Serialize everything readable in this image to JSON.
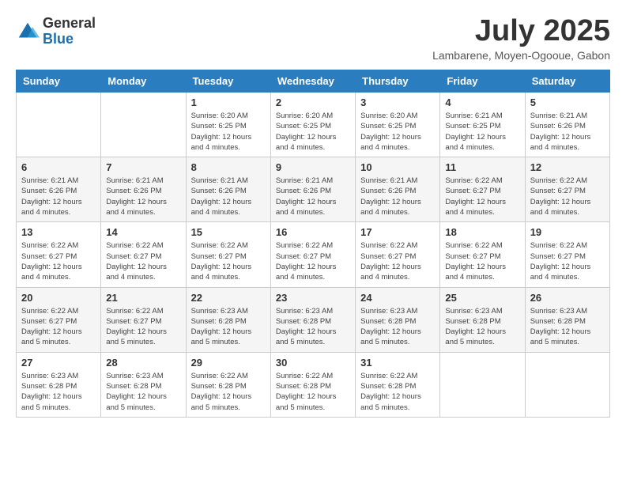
{
  "logo": {
    "general": "General",
    "blue": "Blue"
  },
  "title": "July 2025",
  "subtitle": "Lambarene, Moyen-Ogooue, Gabon",
  "days_of_week": [
    "Sunday",
    "Monday",
    "Tuesday",
    "Wednesday",
    "Thursday",
    "Friday",
    "Saturday"
  ],
  "weeks": [
    [
      {
        "day": "",
        "info": ""
      },
      {
        "day": "",
        "info": ""
      },
      {
        "day": "1",
        "sunrise": "Sunrise: 6:20 AM",
        "sunset": "Sunset: 6:25 PM",
        "daylight": "Daylight: 12 hours and 4 minutes."
      },
      {
        "day": "2",
        "sunrise": "Sunrise: 6:20 AM",
        "sunset": "Sunset: 6:25 PM",
        "daylight": "Daylight: 12 hours and 4 minutes."
      },
      {
        "day": "3",
        "sunrise": "Sunrise: 6:20 AM",
        "sunset": "Sunset: 6:25 PM",
        "daylight": "Daylight: 12 hours and 4 minutes."
      },
      {
        "day": "4",
        "sunrise": "Sunrise: 6:21 AM",
        "sunset": "Sunset: 6:25 PM",
        "daylight": "Daylight: 12 hours and 4 minutes."
      },
      {
        "day": "5",
        "sunrise": "Sunrise: 6:21 AM",
        "sunset": "Sunset: 6:26 PM",
        "daylight": "Daylight: 12 hours and 4 minutes."
      }
    ],
    [
      {
        "day": "6",
        "sunrise": "Sunrise: 6:21 AM",
        "sunset": "Sunset: 6:26 PM",
        "daylight": "Daylight: 12 hours and 4 minutes."
      },
      {
        "day": "7",
        "sunrise": "Sunrise: 6:21 AM",
        "sunset": "Sunset: 6:26 PM",
        "daylight": "Daylight: 12 hours and 4 minutes."
      },
      {
        "day": "8",
        "sunrise": "Sunrise: 6:21 AM",
        "sunset": "Sunset: 6:26 PM",
        "daylight": "Daylight: 12 hours and 4 minutes."
      },
      {
        "day": "9",
        "sunrise": "Sunrise: 6:21 AM",
        "sunset": "Sunset: 6:26 PM",
        "daylight": "Daylight: 12 hours and 4 minutes."
      },
      {
        "day": "10",
        "sunrise": "Sunrise: 6:21 AM",
        "sunset": "Sunset: 6:26 PM",
        "daylight": "Daylight: 12 hours and 4 minutes."
      },
      {
        "day": "11",
        "sunrise": "Sunrise: 6:22 AM",
        "sunset": "Sunset: 6:27 PM",
        "daylight": "Daylight: 12 hours and 4 minutes."
      },
      {
        "day": "12",
        "sunrise": "Sunrise: 6:22 AM",
        "sunset": "Sunset: 6:27 PM",
        "daylight": "Daylight: 12 hours and 4 minutes."
      }
    ],
    [
      {
        "day": "13",
        "sunrise": "Sunrise: 6:22 AM",
        "sunset": "Sunset: 6:27 PM",
        "daylight": "Daylight: 12 hours and 4 minutes."
      },
      {
        "day": "14",
        "sunrise": "Sunrise: 6:22 AM",
        "sunset": "Sunset: 6:27 PM",
        "daylight": "Daylight: 12 hours and 4 minutes."
      },
      {
        "day": "15",
        "sunrise": "Sunrise: 6:22 AM",
        "sunset": "Sunset: 6:27 PM",
        "daylight": "Daylight: 12 hours and 4 minutes."
      },
      {
        "day": "16",
        "sunrise": "Sunrise: 6:22 AM",
        "sunset": "Sunset: 6:27 PM",
        "daylight": "Daylight: 12 hours and 4 minutes."
      },
      {
        "day": "17",
        "sunrise": "Sunrise: 6:22 AM",
        "sunset": "Sunset: 6:27 PM",
        "daylight": "Daylight: 12 hours and 4 minutes."
      },
      {
        "day": "18",
        "sunrise": "Sunrise: 6:22 AM",
        "sunset": "Sunset: 6:27 PM",
        "daylight": "Daylight: 12 hours and 4 minutes."
      },
      {
        "day": "19",
        "sunrise": "Sunrise: 6:22 AM",
        "sunset": "Sunset: 6:27 PM",
        "daylight": "Daylight: 12 hours and 4 minutes."
      }
    ],
    [
      {
        "day": "20",
        "sunrise": "Sunrise: 6:22 AM",
        "sunset": "Sunset: 6:27 PM",
        "daylight": "Daylight: 12 hours and 5 minutes."
      },
      {
        "day": "21",
        "sunrise": "Sunrise: 6:22 AM",
        "sunset": "Sunset: 6:27 PM",
        "daylight": "Daylight: 12 hours and 5 minutes."
      },
      {
        "day": "22",
        "sunrise": "Sunrise: 6:23 AM",
        "sunset": "Sunset: 6:28 PM",
        "daylight": "Daylight: 12 hours and 5 minutes."
      },
      {
        "day": "23",
        "sunrise": "Sunrise: 6:23 AM",
        "sunset": "Sunset: 6:28 PM",
        "daylight": "Daylight: 12 hours and 5 minutes."
      },
      {
        "day": "24",
        "sunrise": "Sunrise: 6:23 AM",
        "sunset": "Sunset: 6:28 PM",
        "daylight": "Daylight: 12 hours and 5 minutes."
      },
      {
        "day": "25",
        "sunrise": "Sunrise: 6:23 AM",
        "sunset": "Sunset: 6:28 PM",
        "daylight": "Daylight: 12 hours and 5 minutes."
      },
      {
        "day": "26",
        "sunrise": "Sunrise: 6:23 AM",
        "sunset": "Sunset: 6:28 PM",
        "daylight": "Daylight: 12 hours and 5 minutes."
      }
    ],
    [
      {
        "day": "27",
        "sunrise": "Sunrise: 6:23 AM",
        "sunset": "Sunset: 6:28 PM",
        "daylight": "Daylight: 12 hours and 5 minutes."
      },
      {
        "day": "28",
        "sunrise": "Sunrise: 6:23 AM",
        "sunset": "Sunset: 6:28 PM",
        "daylight": "Daylight: 12 hours and 5 minutes."
      },
      {
        "day": "29",
        "sunrise": "Sunrise: 6:22 AM",
        "sunset": "Sunset: 6:28 PM",
        "daylight": "Daylight: 12 hours and 5 minutes."
      },
      {
        "day": "30",
        "sunrise": "Sunrise: 6:22 AM",
        "sunset": "Sunset: 6:28 PM",
        "daylight": "Daylight: 12 hours and 5 minutes."
      },
      {
        "day": "31",
        "sunrise": "Sunrise: 6:22 AM",
        "sunset": "Sunset: 6:28 PM",
        "daylight": "Daylight: 12 hours and 5 minutes."
      },
      {
        "day": "",
        "info": ""
      },
      {
        "day": "",
        "info": ""
      }
    ]
  ]
}
